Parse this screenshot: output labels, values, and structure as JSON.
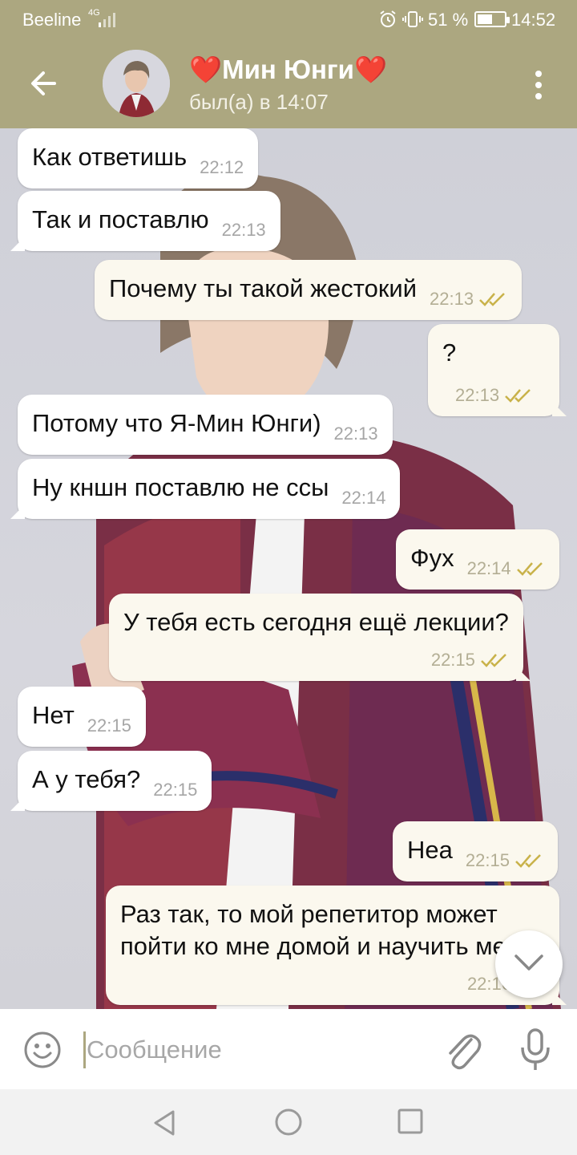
{
  "status_bar": {
    "carrier": "Beeline",
    "network": "4G",
    "battery_percent": "51 %",
    "battery_level": 0.51,
    "time": "14:52"
  },
  "header": {
    "title": "❤️Мин Юнги❤️",
    "last_seen": "был(а) в 14:07",
    "icons": [
      "back-arrow-icon",
      "avatar",
      "more-vert-icon"
    ]
  },
  "messages": [
    {
      "dir": "in",
      "text": "Как ответишь",
      "time": "22:12"
    },
    {
      "dir": "in",
      "text": "Так и поставлю",
      "time": "22:13"
    },
    {
      "dir": "out",
      "text": "Почему ты такой жестокий",
      "time": "22:13",
      "read": true
    },
    {
      "dir": "out",
      "text": "?",
      "time": "22:13",
      "read": true
    },
    {
      "dir": "in",
      "text": "Потому что Я-Мин Юнги)",
      "time": "22:13"
    },
    {
      "dir": "in",
      "text": "Ну кншн поставлю не ссы",
      "time": "22:14"
    },
    {
      "dir": "out",
      "text": "Фух",
      "time": "22:14",
      "read": true
    },
    {
      "dir": "out",
      "text": "У тебя есть сегодня ещё лекции?",
      "time": "22:15",
      "read": true
    },
    {
      "dir": "in",
      "text": "Нет",
      "time": "22:15"
    },
    {
      "dir": "in",
      "text": "А у тебя?",
      "time": "22:15"
    },
    {
      "dir": "out",
      "text": "Неа",
      "time": "22:15",
      "read": true
    },
    {
      "dir": "out",
      "text": "Раз так, то мой репетитор может пойти ко мне домой и научить меня",
      "time": "22:16",
      "read": true
    }
  ],
  "composer": {
    "placeholder": "Сообщение",
    "value": ""
  },
  "colors": {
    "accent": "#aca780",
    "bubble_in": "#ffffff",
    "bubble_out": "#fbf8ee",
    "check": "#c9b24a"
  }
}
